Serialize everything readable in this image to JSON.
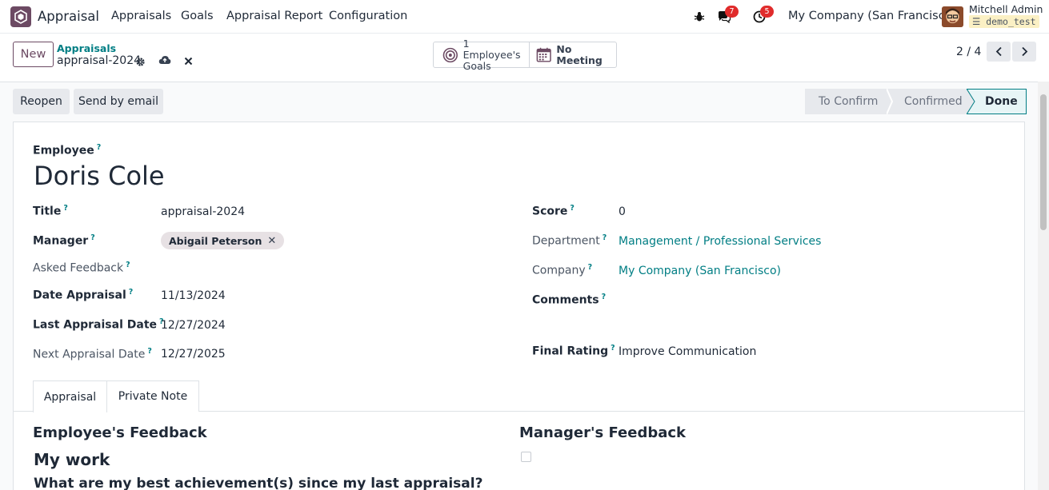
{
  "navbar": {
    "app_name": "Appraisal",
    "menu": [
      "Appraisals",
      "Goals",
      "Appraisal Report",
      "Configuration"
    ],
    "chat_badge": "7",
    "activity_badge": "5",
    "company": "My Company (San Francisco)",
    "user_name": "Mitchell Admin",
    "db_name": "demo_test"
  },
  "control": {
    "new_label": "New",
    "breadcrumb_parent": "Appraisals",
    "breadcrumb_current": "appraisal-2024",
    "goals_line1": "1 Employee's",
    "goals_line2": "Goals",
    "meeting_label": "No Meeting",
    "pager": "2 / 4"
  },
  "actions": {
    "reopen": "Reopen",
    "send_email": "Send by email"
  },
  "status": {
    "stages": [
      "To Confirm",
      "Confirmed",
      "Done"
    ],
    "current": "Done"
  },
  "form": {
    "employee_label": "Employee",
    "employee_name": "Doris Cole",
    "left": {
      "title_label": "Title",
      "title_value": "appraisal-2024",
      "manager_label": "Manager",
      "manager_tag": "Abigail Peterson",
      "asked_feedback_label": "Asked Feedback",
      "date_appraisal_label": "Date Appraisal",
      "date_appraisal_value": "11/13/2024",
      "last_appraisal_label": "Last Appraisal Date",
      "last_appraisal_value": "12/27/2024",
      "next_appraisal_label": "Next Appraisal Date",
      "next_appraisal_value": "12/27/2025"
    },
    "right": {
      "score_label": "Score",
      "score_value": "0",
      "department_label": "Department",
      "department_value": "Management / Professional Services",
      "company_label": "Company",
      "company_value": "My Company (San Francisco)",
      "comments_label": "Comments",
      "final_rating_label": "Final Rating",
      "final_rating_value": "Improve Communication"
    }
  },
  "tabs": [
    "Appraisal",
    "Private Note"
  ],
  "feedback": {
    "employee_heading": "Employee's Feedback",
    "manager_heading": "Manager's Feedback",
    "section_heading": "My work",
    "question": "What are my best achievement(s) since my last appraisal?"
  },
  "colors": {
    "brand": "#6c4a63",
    "link": "#017e84",
    "badge": "#e02b2b"
  }
}
